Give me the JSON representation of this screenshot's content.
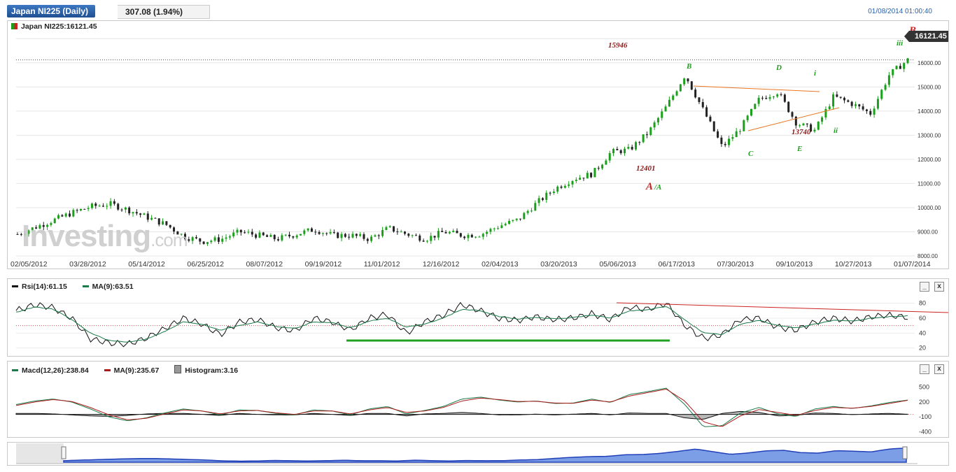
{
  "header": {
    "title": "Japan NI225 (Daily)",
    "change": "307.08 (1.94%)",
    "datetime": "01/08/2014 01:00:40"
  },
  "main_chart": {
    "legend": "Japan NI225:16121.45",
    "last_price": "16121.45",
    "watermark_brand": "Investing",
    "watermark_suffix": ".com",
    "colors": {
      "up": "#1aa01a",
      "down": "#222222",
      "annotation_red": "#cc2222",
      "annotation_green": "#22a022",
      "trendline": "#e87722"
    }
  },
  "rsi_panel": {
    "legend_rsi": "Rsi(14):61.15",
    "legend_ma": "MA(9):63.51",
    "minimize_icon": "_",
    "close_icon": "x"
  },
  "macd_panel": {
    "legend_macd": "Macd(12,26):238.84",
    "legend_ma": "MA(9):235.67",
    "legend_hist": "Histogram:3.16",
    "minimize_icon": "_",
    "close_icon": "x"
  },
  "chart_data": [
    {
      "type": "line",
      "title": "Japan NI225 (Daily)",
      "x_labels": [
        "02/05/2012",
        "03/28/2012",
        "05/14/2012",
        "06/25/2012",
        "08/07/2012",
        "09/19/2012",
        "11/01/2012",
        "12/16/2012",
        "02/04/2013",
        "03/20/2013",
        "05/06/2013",
        "06/17/2013",
        "07/30/2013",
        "09/10/2013",
        "10/27/2013",
        "01/07/2014"
      ],
      "y_ticks": [
        "17000.00",
        "16000.00",
        "15000.00",
        "14000.00",
        "13000.00",
        "12000.00",
        "11000.00",
        "10000.00",
        "9000.00",
        "8000.00"
      ],
      "ylim": [
        8000,
        17500
      ],
      "x": [
        0,
        10,
        20,
        30,
        40,
        50,
        60,
        70,
        80,
        90,
        100,
        110,
        120,
        130,
        140,
        150,
        160,
        170,
        180,
        190,
        200,
        210,
        220,
        230,
        240,
        250,
        260,
        270,
        280,
        290,
        300,
        310,
        320,
        330,
        340,
        350,
        360,
        370,
        380,
        390,
        400,
        410,
        420,
        430,
        440,
        450,
        460,
        470,
        480
      ],
      "close": [
        8900,
        9200,
        9500,
        9800,
        10050,
        10150,
        9900,
        9600,
        9300,
        8800,
        8600,
        8700,
        9000,
        8850,
        8700,
        8900,
        9100,
        8850,
        8850,
        8700,
        9150,
        8900,
        8700,
        9000,
        8850,
        8900,
        9250,
        9500,
        10200,
        10800,
        11200,
        11400,
        12300,
        12400,
        13100,
        14200,
        15500,
        14000,
        12500,
        13300,
        14500,
        14800,
        13500,
        13200,
        14600,
        14300,
        13900,
        15500,
        16121.45
      ],
      "annotations": [
        {
          "text": "15946",
          "value": 15946,
          "color": "#8b1a1a"
        },
        {
          "text": "12401",
          "value": 12401,
          "color": "#8b1a1a"
        },
        {
          "text": "13740",
          "value": 13740,
          "color": "#8b1a1a"
        },
        {
          "text": "A",
          "color": "#cc2222"
        },
        {
          "text": "/A",
          "color": "#22a022"
        },
        {
          "text": "B",
          "color": "#22a022"
        },
        {
          "text": "C",
          "color": "#22a022"
        },
        {
          "text": "D",
          "color": "#22a022"
        },
        {
          "text": "E",
          "color": "#22a022"
        },
        {
          "text": "i",
          "color": "#22a022"
        },
        {
          "text": "ii",
          "color": "#22a022"
        },
        {
          "text": "iii",
          "color": "#22a022"
        },
        {
          "text": "B",
          "color": "#cc2222"
        }
      ]
    },
    {
      "type": "line",
      "title": "",
      "y_ticks": [
        "80",
        "60",
        "40",
        "20"
      ],
      "ylim": [
        15,
        90
      ],
      "series": [
        {
          "name": "Rsi(14)",
          "values": [
            70,
            78,
            74,
            60,
            32,
            27,
            25,
            33,
            46,
            60,
            52,
            38,
            55,
            58,
            47,
            43,
            60,
            55,
            44,
            60,
            65,
            40,
            55,
            64,
            78,
            70,
            60,
            57,
            62,
            58,
            60,
            66,
            58,
            75,
            72,
            80,
            50,
            33,
            38,
            58,
            60,
            48,
            44,
            55,
            60,
            56,
            62,
            64,
            61
          ]
        },
        {
          "name": "MA(9)",
          "values": [
            68,
            75,
            72,
            58,
            40,
            30,
            28,
            32,
            42,
            55,
            52,
            44,
            50,
            55,
            49,
            46,
            55,
            54,
            47,
            56,
            60,
            48,
            52,
            60,
            72,
            70,
            62,
            59,
            61,
            59,
            61,
            64,
            60,
            70,
            71,
            76,
            58,
            40,
            38,
            52,
            57,
            50,
            47,
            52,
            57,
            56,
            60,
            62,
            63.5
          ]
        }
      ]
    },
    {
      "type": "line",
      "title": "",
      "y_ticks": [
        "500",
        "200",
        "-100",
        "-400"
      ],
      "ylim": [
        -450,
        650
      ],
      "series": [
        {
          "name": "Macd(12,26)",
          "values": [
            150,
            220,
            260,
            200,
            60,
            -100,
            -180,
            -120,
            -20,
            60,
            20,
            -60,
            40,
            30,
            -30,
            -60,
            40,
            20,
            -60,
            60,
            110,
            -40,
            30,
            110,
            260,
            300,
            240,
            200,
            220,
            170,
            180,
            260,
            190,
            350,
            410,
            480,
            150,
            -300,
            -280,
            -20,
            90,
            -40,
            -90,
            60,
            110,
            70,
            120,
            190,
            238.84
          ]
        },
        {
          "name": "MA(9)",
          "values": [
            130,
            200,
            250,
            210,
            90,
            -60,
            -160,
            -130,
            -40,
            40,
            20,
            -40,
            20,
            30,
            -20,
            -50,
            20,
            20,
            -40,
            40,
            90,
            -10,
            20,
            90,
            220,
            280,
            250,
            210,
            215,
            180,
            175,
            240,
            200,
            320,
            390,
            460,
            220,
            -200,
            -300,
            -80,
            50,
            -10,
            -70,
            30,
            90,
            75,
            110,
            170,
            235.67
          ]
        },
        {
          "name": "Histogram",
          "values": [
            20,
            20,
            10,
            -10,
            -30,
            -40,
            -20,
            10,
            20,
            20,
            0,
            -20,
            20,
            0,
            -10,
            -10,
            20,
            0,
            -20,
            20,
            20,
            -30,
            10,
            20,
            40,
            20,
            -10,
            -10,
            5,
            -10,
            5,
            20,
            -10,
            30,
            20,
            20,
            -70,
            -100,
            20,
            60,
            40,
            -30,
            -20,
            30,
            20,
            -5,
            10,
            20,
            3.16
          ]
        }
      ]
    }
  ]
}
